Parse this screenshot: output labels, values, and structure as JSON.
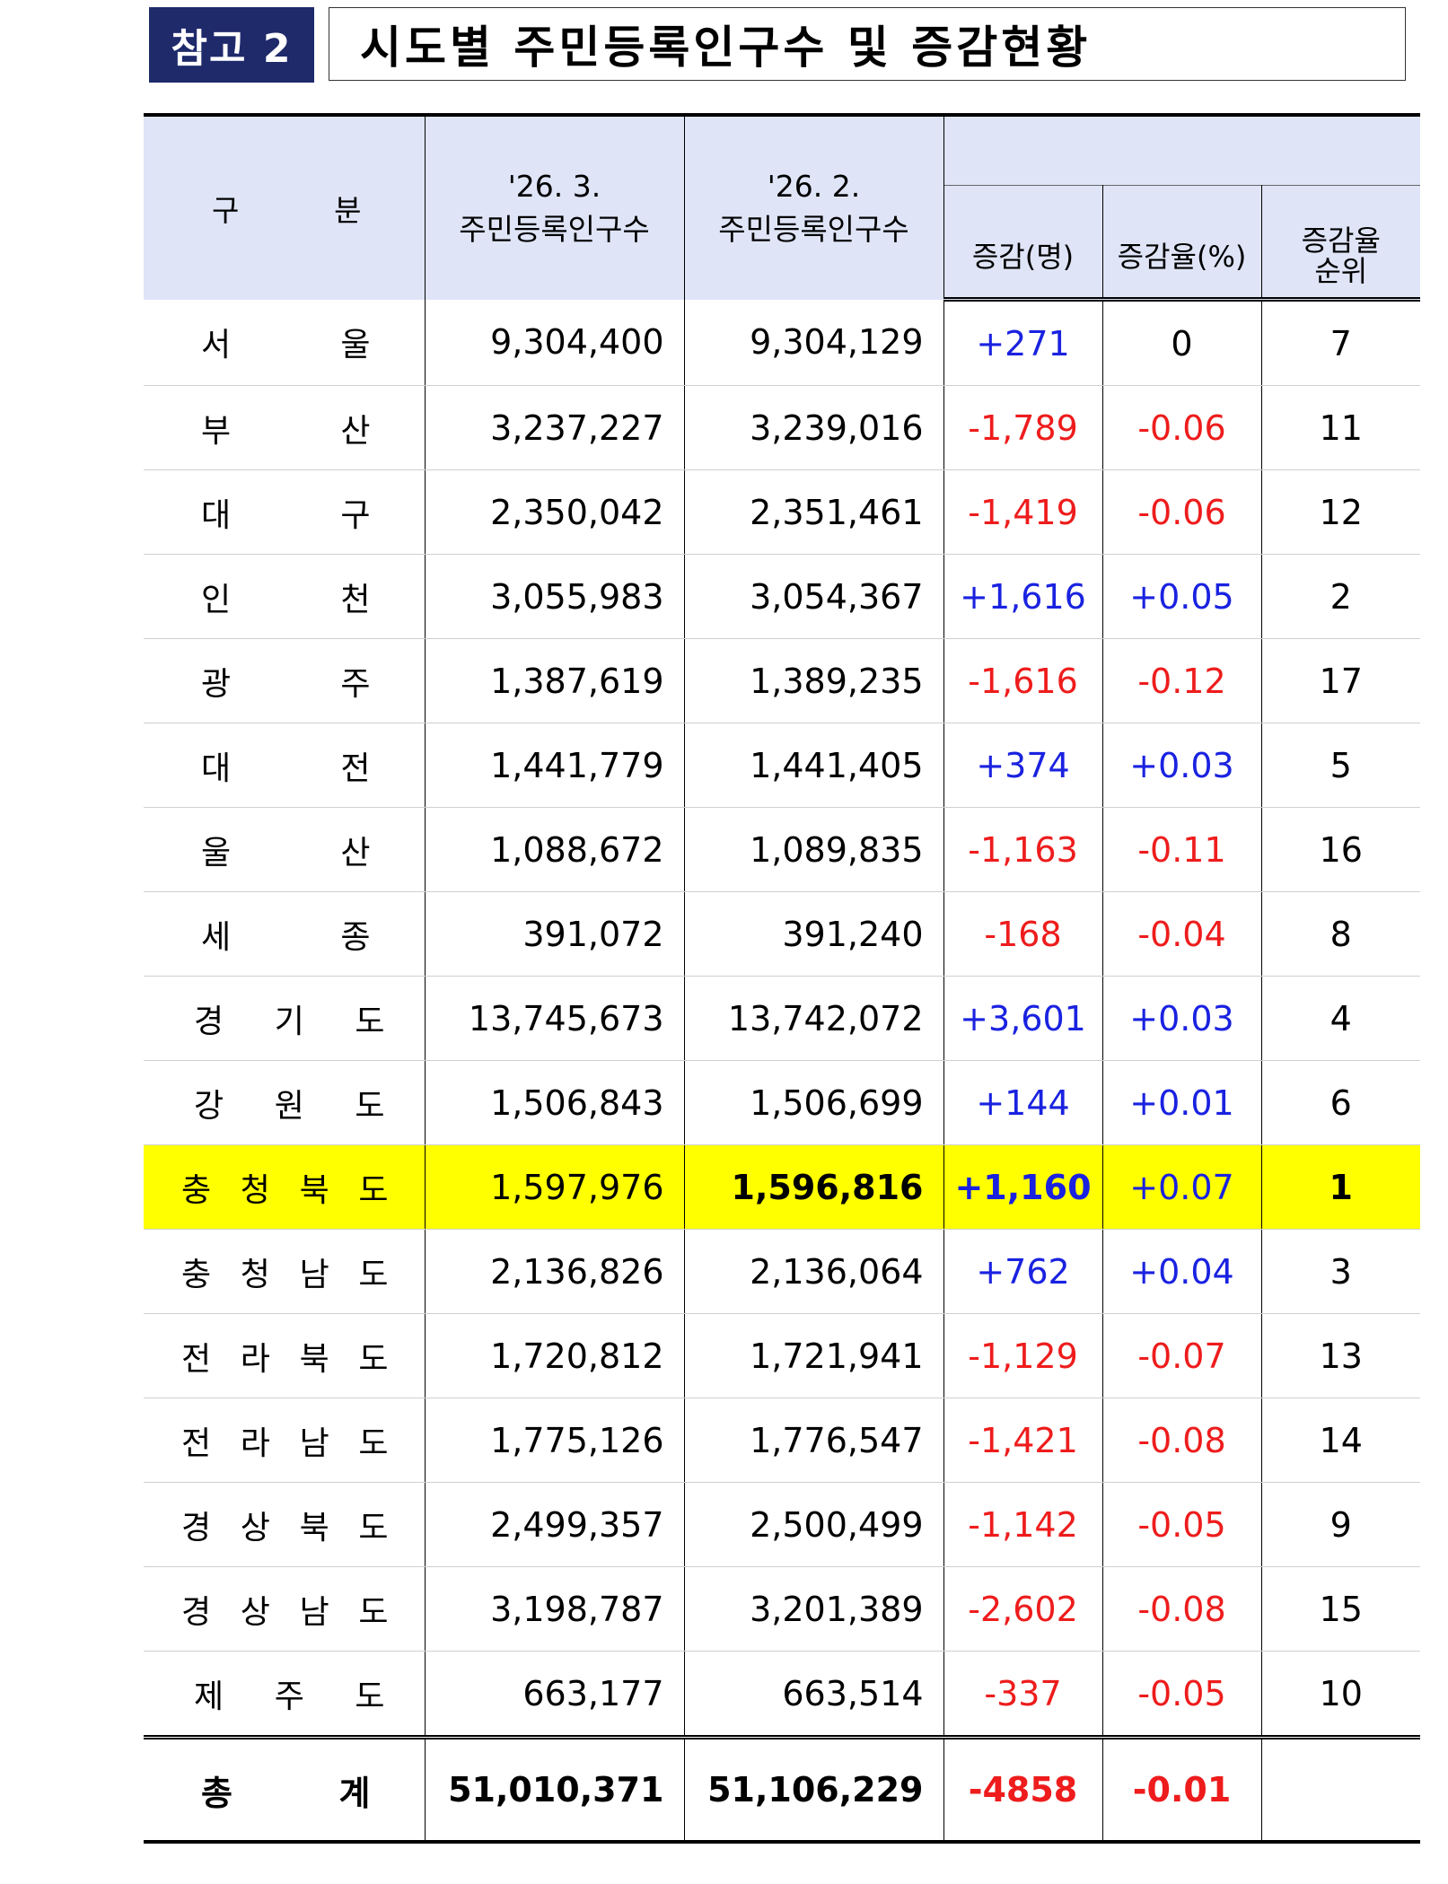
{
  "header": {
    "badge": "참고 2",
    "title": "시도별 주민등록인구수 및 증감현황"
  },
  "table": {
    "col_region": [
      "구",
      "분"
    ],
    "col_cur_date": "'26. 3.",
    "col_cur_label": "주민등록인구수",
    "col_prev_date": "'26. 2.",
    "col_prev_label": "주민등록인구수",
    "col_change": "증감(명)",
    "col_rate": "증감율(%)",
    "col_rank_1": "증감율",
    "col_rank_2": "순위",
    "rows": [
      {
        "region": [
          "서",
          "울"
        ],
        "cur": "9,304,400",
        "prev": "9,304,129",
        "change": "+271",
        "rate": "0",
        "rank": "7"
      },
      {
        "region": [
          "부",
          "산"
        ],
        "cur": "3,237,227",
        "prev": "3,239,016",
        "change": "-1,789",
        "rate": "-0.06",
        "rank": "11"
      },
      {
        "region": [
          "대",
          "구"
        ],
        "cur": "2,350,042",
        "prev": "2,351,461",
        "change": "-1,419",
        "rate": "-0.06",
        "rank": "12"
      },
      {
        "region": [
          "인",
          "천"
        ],
        "cur": "3,055,983",
        "prev": "3,054,367",
        "change": "+1,616",
        "rate": "+0.05",
        "rank": "2"
      },
      {
        "region": [
          "광",
          "주"
        ],
        "cur": "1,387,619",
        "prev": "1,389,235",
        "change": "-1,616",
        "rate": "-0.12",
        "rank": "17"
      },
      {
        "region": [
          "대",
          "전"
        ],
        "cur": "1,441,779",
        "prev": "1,441,405",
        "change": "+374",
        "rate": "+0.03",
        "rank": "5"
      },
      {
        "region": [
          "울",
          "산"
        ],
        "cur": "1,088,672",
        "prev": "1,089,835",
        "change": "-1,163",
        "rate": "-0.11",
        "rank": "16"
      },
      {
        "region": [
          "세",
          "종"
        ],
        "cur": "391,072",
        "prev": "391,240",
        "change": "-168",
        "rate": "-0.04",
        "rank": "8"
      },
      {
        "region": [
          "경",
          "기",
          "도"
        ],
        "cur": "13,745,673",
        "prev": "13,742,072",
        "change": "+3,601",
        "rate": "+0.03",
        "rank": "4"
      },
      {
        "region": [
          "강",
          "원",
          "도"
        ],
        "cur": "1,506,843",
        "prev": "1,506,699",
        "change": "+144",
        "rate": "+0.01",
        "rank": "6"
      },
      {
        "region": [
          "충",
          "청",
          "북",
          "도"
        ],
        "cur": "1,597,976",
        "prev": "1,596,816",
        "change": "+1,160",
        "rate": "+0.07",
        "rank": "1",
        "highlight": true
      },
      {
        "region": [
          "충",
          "청",
          "남",
          "도"
        ],
        "cur": "2,136,826",
        "prev": "2,136,064",
        "change": "+762",
        "rate": "+0.04",
        "rank": "3"
      },
      {
        "region": [
          "전",
          "라",
          "북",
          "도"
        ],
        "cur": "1,720,812",
        "prev": "1,721,941",
        "change": "-1,129",
        "rate": "-0.07",
        "rank": "13"
      },
      {
        "region": [
          "전",
          "라",
          "남",
          "도"
        ],
        "cur": "1,775,126",
        "prev": "1,776,547",
        "change": "-1,421",
        "rate": "-0.08",
        "rank": "14"
      },
      {
        "region": [
          "경",
          "상",
          "북",
          "도"
        ],
        "cur": "2,499,357",
        "prev": "2,500,499",
        "change": "-1,142",
        "rate": "-0.05",
        "rank": "9"
      },
      {
        "region": [
          "경",
          "상",
          "남",
          "도"
        ],
        "cur": "3,198,787",
        "prev": "3,201,389",
        "change": "-2,602",
        "rate": "-0.08",
        "rank": "15"
      },
      {
        "region": [
          "제",
          "주",
          "도"
        ],
        "cur": "663,177",
        "prev": "663,514",
        "change": "-337",
        "rate": "-0.05",
        "rank": "10"
      }
    ],
    "total": {
      "region": [
        "총",
        "계"
      ],
      "cur": "51,010,371",
      "prev": "51,106,229",
      "change": "-4858",
      "rate": "-0.01",
      "rank": ""
    }
  },
  "colors": {
    "positive": "#1a22e0",
    "negative": "#ee1c1c",
    "highlight": "#ffff00",
    "header_bg": "#dfe5f7",
    "badge_bg": "#1f2a6b"
  }
}
